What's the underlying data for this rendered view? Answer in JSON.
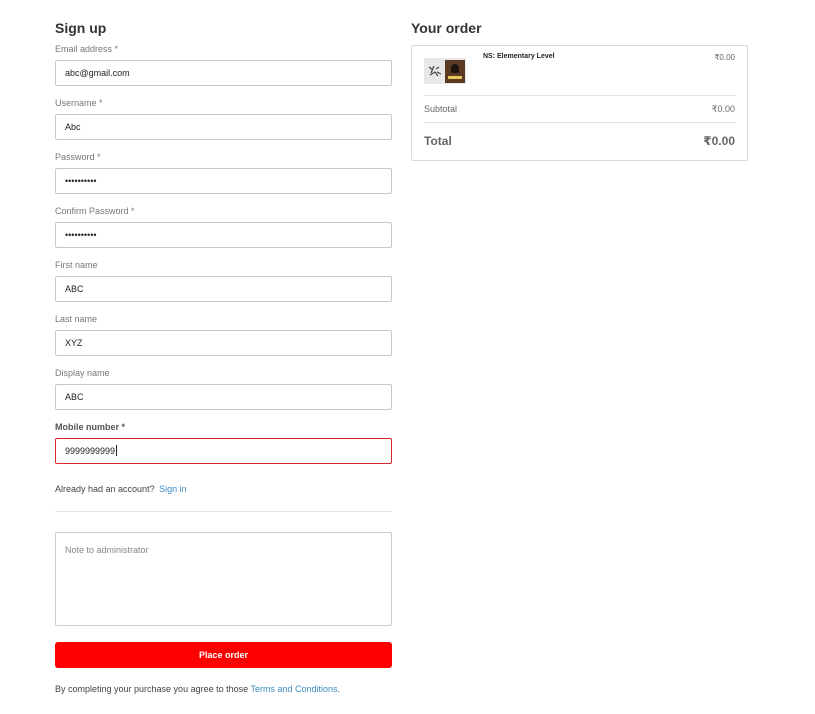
{
  "signup": {
    "title": "Sign up",
    "fields": [
      {
        "label": "Email address *",
        "value": "abc@gmail.com"
      },
      {
        "label": "Username *",
        "value": "Abc"
      },
      {
        "label": "Password *",
        "value": "••••••••••"
      },
      {
        "label": "Confirm Password *",
        "value": "••••••••••"
      },
      {
        "label": "First name",
        "value": "ABC"
      },
      {
        "label": "Last name",
        "value": "XYZ"
      },
      {
        "label": "Display name",
        "value": "ABC"
      },
      {
        "label": "Mobile number *",
        "value": "9999999999"
      }
    ],
    "account_prompt": "Already had an account?",
    "signin_link": "Sign in",
    "note_placeholder": "Note to administrator",
    "place_order": "Place order",
    "terms_text": "By completing your purchase you agree to those",
    "terms_link": "Terms and Conditions",
    "terms_end": "."
  },
  "order": {
    "title": "Your order",
    "item": {
      "name": "NS: Elementary Level",
      "price": "₹0.00",
      "thumbnail": "course-thumbnail"
    },
    "subtotal_label": "Subtotal",
    "subtotal": "₹0.00",
    "total_label": "Total",
    "total": "₹0.00"
  },
  "colors": {
    "primary": "#ff0000",
    "link": "#3c8dc5",
    "error_border": "#d9262b"
  }
}
